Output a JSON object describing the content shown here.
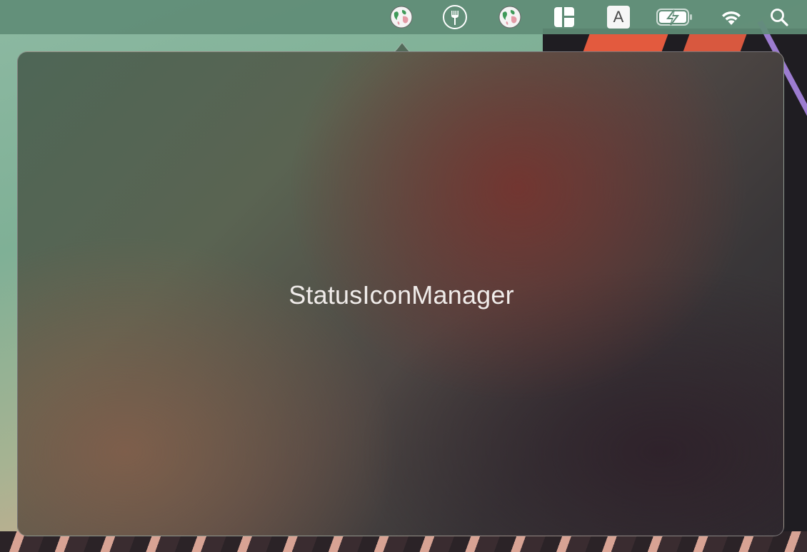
{
  "popover": {
    "title": "StatusIconManager"
  },
  "menubar": {
    "items": [
      {
        "icon": "globe-icon"
      },
      {
        "icon": "fork-icon"
      },
      {
        "icon": "globe-icon"
      },
      {
        "icon": "layout-icon"
      },
      {
        "icon": "input-source-icon",
        "label": "A"
      },
      {
        "icon": "battery-charging-icon"
      },
      {
        "icon": "wifi-icon"
      },
      {
        "icon": "spotlight-search-icon"
      }
    ]
  },
  "colors": {
    "menubar": "#5f8c76",
    "popover_text": "#f0ecea"
  }
}
